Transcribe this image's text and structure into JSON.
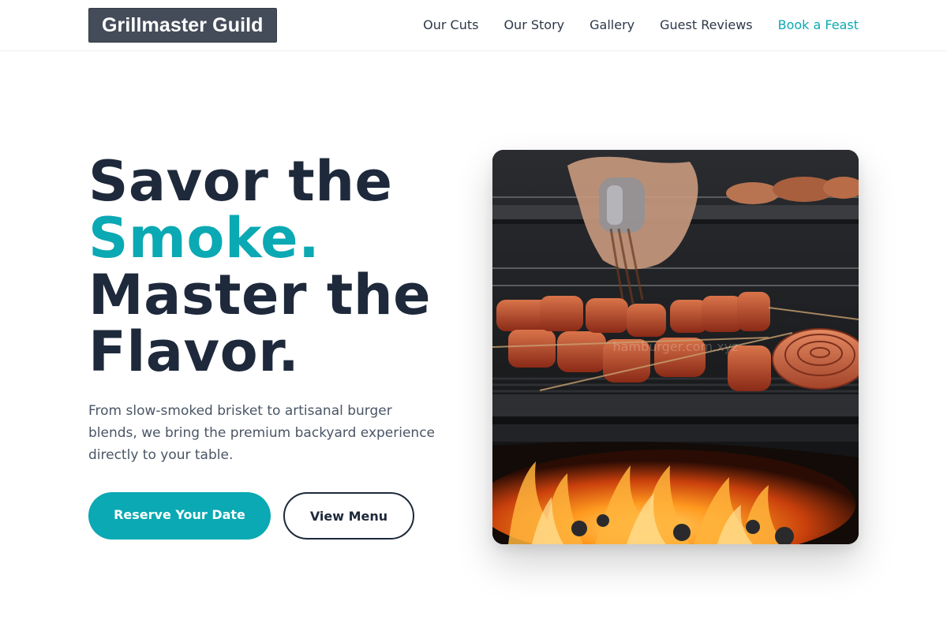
{
  "brand": {
    "name": "Grillmaster Guild"
  },
  "nav": {
    "items": [
      {
        "label": "Our Cuts"
      },
      {
        "label": "Our Story"
      },
      {
        "label": "Gallery"
      },
      {
        "label": "Guest Reviews"
      },
      {
        "label": "Book a Feast"
      }
    ]
  },
  "hero": {
    "title_line1": "Savor the",
    "title_accent": "Smoke.",
    "title_line3": "Master the",
    "title_line4": "Flavor.",
    "subtitle": "From slow-smoked brisket to artisanal burger blends, we bring the premium backyard experience directly to your table.",
    "primary_cta": "Reserve Your Date",
    "secondary_cta": "View Menu",
    "image_watermark": "hamburger.com.xyz"
  },
  "colors": {
    "accent": "#0aa9b3",
    "heading": "#1e293b",
    "logo_bg": "#454c59",
    "body_text": "#4a5565"
  }
}
